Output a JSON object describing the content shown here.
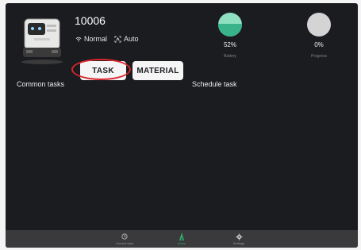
{
  "robot": {
    "id": "10006",
    "status": "Normal",
    "mode": "Auto"
  },
  "buttons": {
    "task": "TASK",
    "material": "MATERIAL"
  },
  "sections": {
    "common": "Common tasks",
    "schedule": "Schedule task"
  },
  "gauges": {
    "battery": {
      "value": "52%",
      "level": 0.52,
      "label": "Battery",
      "color": "#39b38a"
    },
    "progress": {
      "value": "0%",
      "level": 0.0,
      "label": "Progress",
      "color": "#d4d4d4"
    }
  },
  "nav": [
    {
      "label": "Current task",
      "icon": "clock-icon"
    },
    {
      "label": "Home",
      "icon": "home-icon",
      "active": true
    },
    {
      "label": "Settings",
      "icon": "gear-icon"
    }
  ],
  "colors": {
    "background": "#1b1c20",
    "highlight": "#d9252c",
    "accent": "#3aa86e"
  }
}
